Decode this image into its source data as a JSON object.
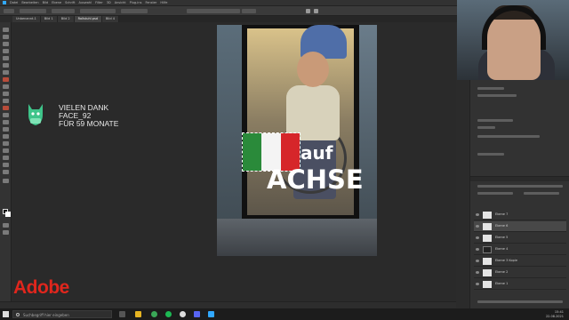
{
  "menubar": {
    "items": [
      "Datei",
      "Bearbeiten",
      "Bild",
      "Ebene",
      "Schrift",
      "Auswahl",
      "Filter",
      "3D",
      "Ansicht",
      "Plug-ins",
      "Fenster",
      "Hilfe"
    ]
  },
  "tabs": {
    "items": [
      "Unbenannt-1",
      "Bild 1",
      "Bild 2",
      "Rollstuhl.psd",
      "Bild 4"
    ]
  },
  "canvas": {
    "text_line1": "auf",
    "text_line2": "ACHSE",
    "flag_colors": [
      "#2a8a3a",
      "#f4f4f4",
      "#d6262a"
    ]
  },
  "overlay": {
    "line1": "VIELEN DANK",
    "line2": "FACE_92",
    "line3": "FÜR 59 MONATE",
    "mascot_icon": "green-cat-mascot-icon"
  },
  "brand": {
    "logo_text": "Adobe",
    "logo_color": "#e0261d"
  },
  "layers": {
    "items": [
      "Ebene 7",
      "Ebene 6",
      "Ebene 5",
      "Ebene 4",
      "Ebene 3 Kopie",
      "Ebene 2",
      "Ebene 1"
    ]
  },
  "taskbar": {
    "search_placeholder": "Suchbegriff hier eingeben",
    "time": "15:41",
    "date": "22.08.2021"
  }
}
